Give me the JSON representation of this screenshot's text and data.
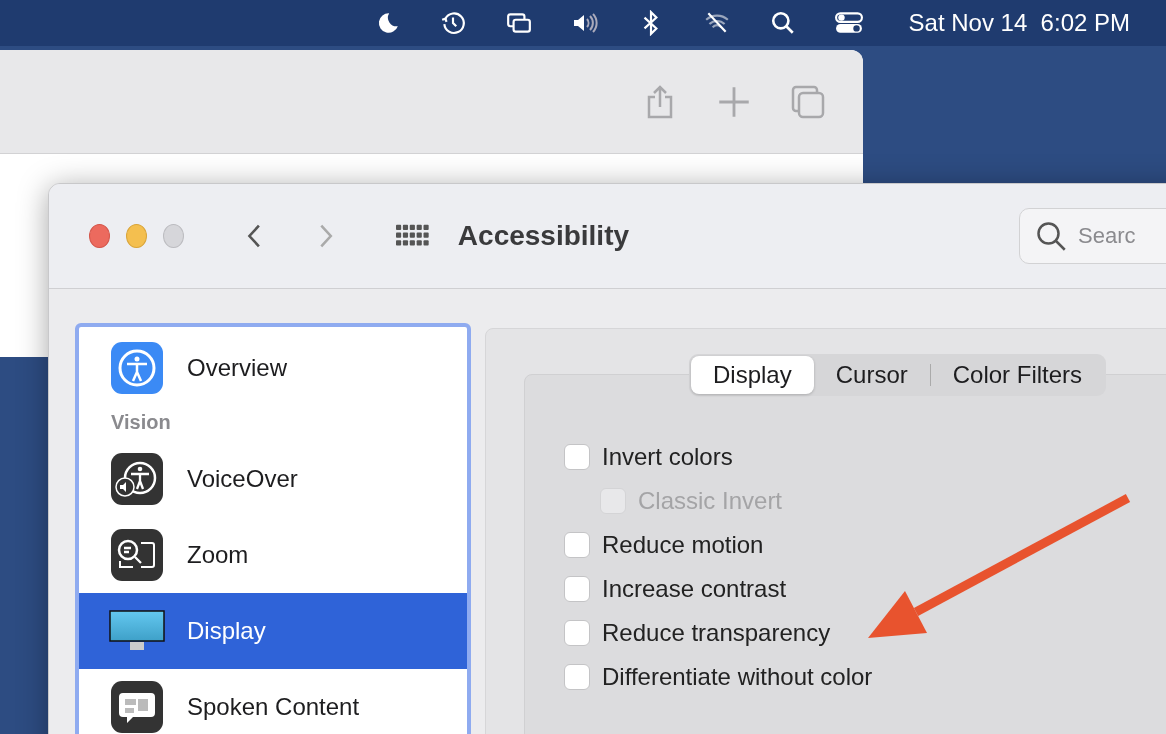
{
  "menu_bar": {
    "clock": "Sat Nov 14  6:02 PM"
  },
  "window": {
    "title": "Accessibility",
    "back": {
      "disabled": false
    },
    "forward": {
      "disabled": true
    },
    "search": {
      "placeholder": "Searc"
    }
  },
  "sidebar": {
    "items": [
      {
        "kind": "item",
        "label": "Overview",
        "selected": false
      },
      {
        "kind": "header",
        "label": "Vision"
      },
      {
        "kind": "item",
        "label": "VoiceOver",
        "selected": false
      },
      {
        "kind": "item",
        "label": "Zoom",
        "selected": false
      },
      {
        "kind": "item",
        "label": "Display",
        "selected": true
      },
      {
        "kind": "item",
        "label": "Spoken Content",
        "selected": false
      }
    ]
  },
  "tabs": [
    {
      "label": "Display",
      "selected": true
    },
    {
      "label": "Cursor",
      "selected": false
    },
    {
      "label": "Color Filters",
      "selected": false
    }
  ],
  "options": [
    {
      "label": "Invert colors",
      "checked": false,
      "disabled": false,
      "children": [
        {
          "label": "Classic Invert",
          "checked": false,
          "disabled": true
        }
      ]
    },
    {
      "label": "Reduce motion",
      "checked": false,
      "disabled": false
    },
    {
      "label": "Increase contrast",
      "checked": false,
      "disabled": false
    },
    {
      "label": "Reduce transparency",
      "checked": false,
      "disabled": false
    },
    {
      "label": "Differentiate without color",
      "checked": false,
      "disabled": false
    }
  ]
}
